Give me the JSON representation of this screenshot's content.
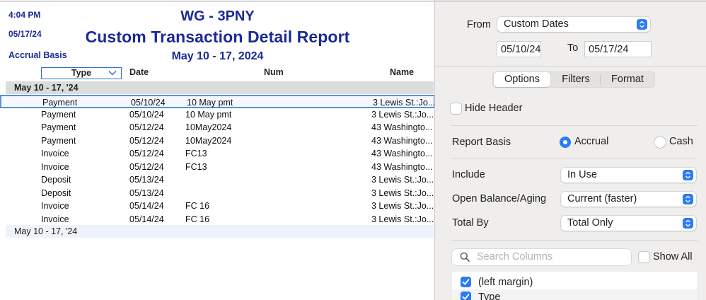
{
  "report": {
    "time": "4:04 PM",
    "date": "05/17/24",
    "basis": "Accrual Basis",
    "company": "WG - 3PNY",
    "title": "Custom Transaction Detail Report",
    "range": "May 10 - 17, 2024",
    "columns": {
      "type": "Type",
      "date": "Date",
      "num": "Num",
      "name": "Name"
    },
    "group_header": "May 10 - 17, '24",
    "group_footer": "May 10 - 17, '24",
    "rows": [
      {
        "type": "Payment",
        "date": "05/10/24",
        "num": "10 May pmt",
        "name": "3 Lewis St.:Jo..."
      },
      {
        "type": "Payment",
        "date": "05/10/24",
        "num": "10 May pmt",
        "name": "3 Lewis St.:Jo..."
      },
      {
        "type": "Payment",
        "date": "05/12/24",
        "num": "10May2024",
        "name": "43 Washingto..."
      },
      {
        "type": "Payment",
        "date": "05/12/24",
        "num": "10May2024",
        "name": "43 Washingto..."
      },
      {
        "type": "Invoice",
        "date": "05/12/24",
        "num": "FC13",
        "name": "43 Washingto..."
      },
      {
        "type": "Invoice",
        "date": "05/12/24",
        "num": "FC13",
        "name": "43 Washingto..."
      },
      {
        "type": "Deposit",
        "date": "05/13/24",
        "num": "",
        "name": "3 Lewis St.:Jo..."
      },
      {
        "type": "Deposit",
        "date": "05/13/24",
        "num": "",
        "name": "3 Lewis St.:Jo..."
      },
      {
        "type": "Invoice",
        "date": "05/14/24",
        "num": "FC 16",
        "name": "3 Lewis St.:Jo..."
      },
      {
        "type": "Invoice",
        "date": "05/14/24",
        "num": "FC 16",
        "name": "3 Lewis St.:Jo..."
      }
    ]
  },
  "options": {
    "from_label": "From",
    "from_value": "Custom Dates",
    "start_date": "05/10/24",
    "to_label": "To",
    "end_date": "05/17/24",
    "tabs": [
      "Options",
      "Filters",
      "Format"
    ],
    "active_tab": "Options",
    "hide_header_label": "Hide Header",
    "hide_header_checked": false,
    "report_basis_label": "Report Basis",
    "basis_accrual": "Accrual",
    "basis_cash": "Cash",
    "basis_selected": "Accrual",
    "include_label": "Include",
    "include_value": "In Use",
    "aging_label": "Open Balance/Aging",
    "aging_value": "Current (faster)",
    "total_by_label": "Total By",
    "total_by_value": "Total Only",
    "search_placeholder": "Search Columns",
    "show_all_label": "Show All",
    "show_all_checked": false,
    "columns_list": [
      {
        "label": "(left margin)",
        "checked": true
      },
      {
        "label": "Type",
        "checked": true
      }
    ]
  },
  "colors": {
    "header_text": "#1a2a96",
    "accent": "#2a7cf5",
    "selection_border": "#5a8fe0",
    "group_header_bg": "#dcdcdc",
    "side_bg": "#efeeed"
  },
  "icons": {
    "dropdown": "chevron-down-icon",
    "popup_arrows": "up-down-arrows-icon",
    "search": "search-icon",
    "checkmark": "checkmark-icon"
  }
}
